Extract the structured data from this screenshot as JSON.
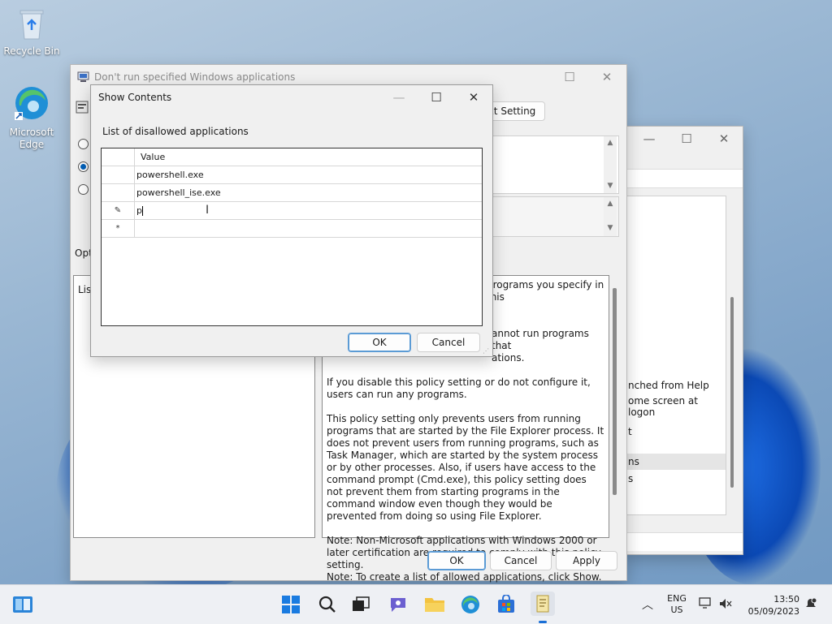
{
  "desktop": {
    "recycle_bin_label": "Recycle Bin",
    "edge_label_1": "Microsoft",
    "edge_label_2": "Edge"
  },
  "policy_window": {
    "title": "Don't run specified Windows applications",
    "next_setting_label": "xt Setting",
    "options_label": "Opt",
    "list_label": "List",
    "ok_label": "OK",
    "cancel_label": "Cancel",
    "apply_label": "Apply",
    "help_paragraphs": [
      "programs you specify in this",
      "annot run programs that",
      "ations.",
      "If you disable this policy setting or do not configure it, users can run any programs.",
      "This policy setting only prevents users from running programs that are started by the File Explorer process. It does not prevent users from running programs, such as Task Manager, which are started by the system process or by other processes.  Also, if users have access to the command prompt (Cmd.exe), this policy setting does not prevent them from starting programs in the command window even though they would be prevented from doing so using File Explorer.",
      "Note: Non-Microsoft applications with Windows 2000 or later certification are required to comply with this policy setting.",
      "Note: To create a list of allowed applications, click Show.  In the"
    ],
    "radio_selected_index": 1
  },
  "gpe_window": {
    "list_items": [
      "nched from Help",
      "ome screen at logon",
      "t",
      "ns",
      "s"
    ]
  },
  "show_contents": {
    "title": "Show Contents",
    "list_caption": "List of disallowed applications",
    "column_header": "Value",
    "rows": [
      {
        "marker": "",
        "value": "powershell.exe"
      },
      {
        "marker": "",
        "value": "powershell_ise.exe"
      },
      {
        "marker": "✎",
        "value": "p"
      },
      {
        "marker": "*",
        "value": ""
      }
    ],
    "ok_label": "OK",
    "cancel_label": "Cancel"
  },
  "taskbar": {
    "lang_1": "ENG",
    "lang_2": "US",
    "time": "13:50",
    "date": "05/09/2023"
  }
}
